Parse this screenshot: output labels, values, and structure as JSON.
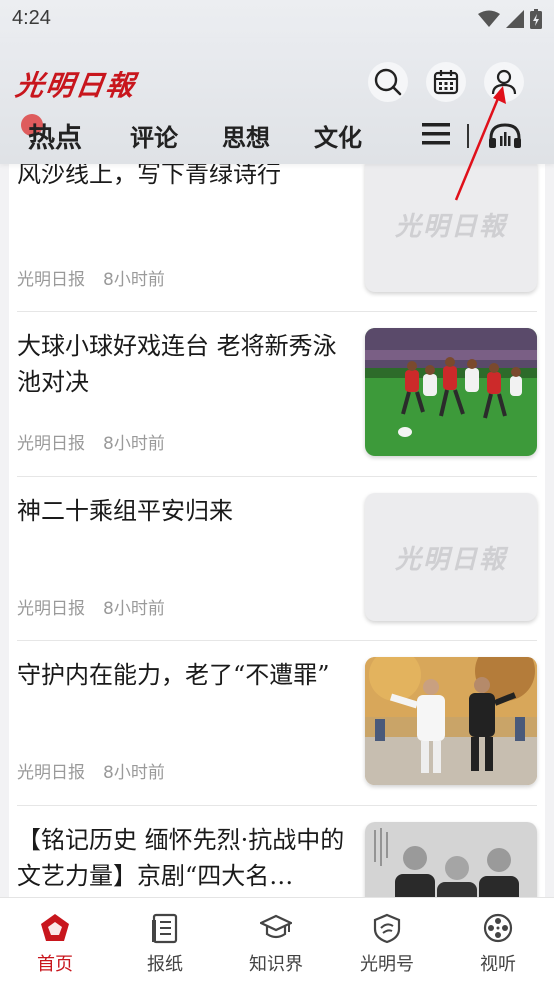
{
  "status_bar": {
    "time": "4:24"
  },
  "header": {
    "logo": "光明日報",
    "tabs": [
      "热点",
      "评论",
      "思想",
      "文化"
    ]
  },
  "feed": {
    "items": [
      {
        "title": "风沙线上，写下青绿诗行",
        "source": "光明日报",
        "time": "8小时前",
        "thumb": "placeholder",
        "placeholder_text": "光明日報"
      },
      {
        "title": "大球小球好戏连台 老将新秀泳池对决",
        "source": "光明日报",
        "time": "8小时前",
        "thumb": "rugby-photo"
      },
      {
        "title": "神二十乘组平安归来",
        "source": "光明日报",
        "time": "8小时前",
        "thumb": "placeholder",
        "placeholder_text": "光明日報"
      },
      {
        "title": "守护内在能力，老了“不遭罪”",
        "source": "光明日报",
        "time": "8小时前",
        "thumb": "taichi-photo"
      },
      {
        "title": "【铭记历史 缅怀先烈·抗战中的文艺力量】京剧“四大名…",
        "source": "",
        "time": "",
        "thumb": "peking-opera-photo"
      }
    ]
  },
  "bottom_nav": {
    "items": [
      "首页",
      "报纸",
      "知识界",
      "光明号",
      "视听"
    ]
  },
  "colors": {
    "brand": "#c8161d",
    "annotation_arrow": "#e0101a"
  }
}
